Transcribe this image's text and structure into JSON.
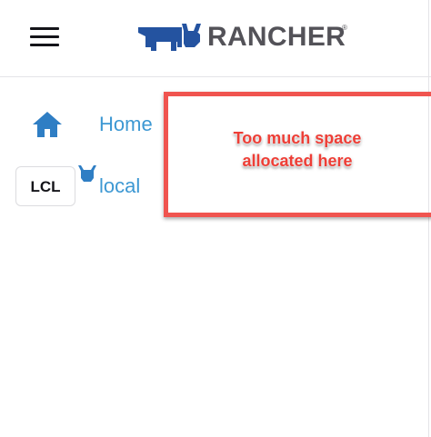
{
  "header": {
    "menu_icon": "hamburger-menu-icon",
    "brand_name": "RANCHER",
    "brand_mark": "®",
    "brand_color": "#2453a0"
  },
  "nav": {
    "home": {
      "icon": "home-icon",
      "label": "Home"
    },
    "local": {
      "badge": "LCL",
      "badge_icon": "rancher-cow-icon",
      "label": "local"
    }
  },
  "annotation": {
    "line1": "Too much space",
    "line2": "allocated here",
    "color": "#f0544f"
  },
  "colors": {
    "link": "#3d98d3",
    "brand_text": "#535258"
  }
}
